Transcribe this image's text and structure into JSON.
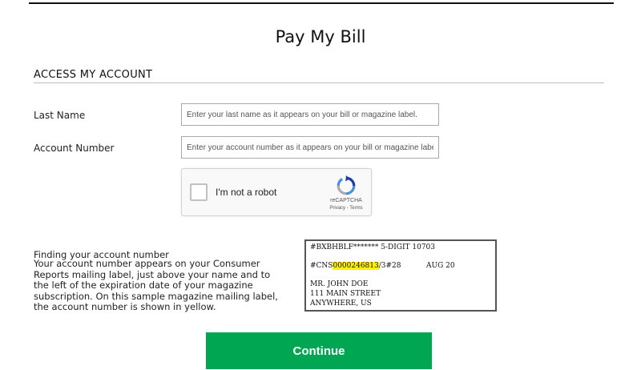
{
  "page": {
    "title": "Pay My Bill"
  },
  "section": {
    "title": "ACCESS MY ACCOUNT"
  },
  "form": {
    "last_name": {
      "label": "Last Name",
      "placeholder": "Enter your last name as it appears on your bill or magazine label.",
      "value": ""
    },
    "account_number": {
      "label": "Account Number",
      "placeholder": "Enter your account number as it appears on your bill or magazine label.",
      "value": ""
    }
  },
  "captcha": {
    "label": "I'm not a robot",
    "brand": "reCAPTCHA",
    "privacy": "Privacy",
    "separator": " - ",
    "terms": "Terms",
    "checked": false
  },
  "help": {
    "heading": "Finding your account number",
    "body": "Your account number appears on your Consumer Reports mailing label, just above your name and to the left of the expiration date of your magazine subscription. On this sample magazine mailing label, the account number is shown in yellow."
  },
  "sample_label": {
    "line1": "#BXBHBLF******* 5-DIGIT 10703",
    "line2_prefix": "#CNS",
    "line2_account": "0000246813",
    "line2_suffix": "/3#28",
    "line2_date": "AUG 20",
    "line3": "MR. JOHN DOE",
    "line4": "111 MAIN STREET",
    "line5": "ANYWHERE, US",
    "highlight_color": "#fff200"
  },
  "actions": {
    "continue_label": "Continue",
    "button_color": "#00a651"
  }
}
